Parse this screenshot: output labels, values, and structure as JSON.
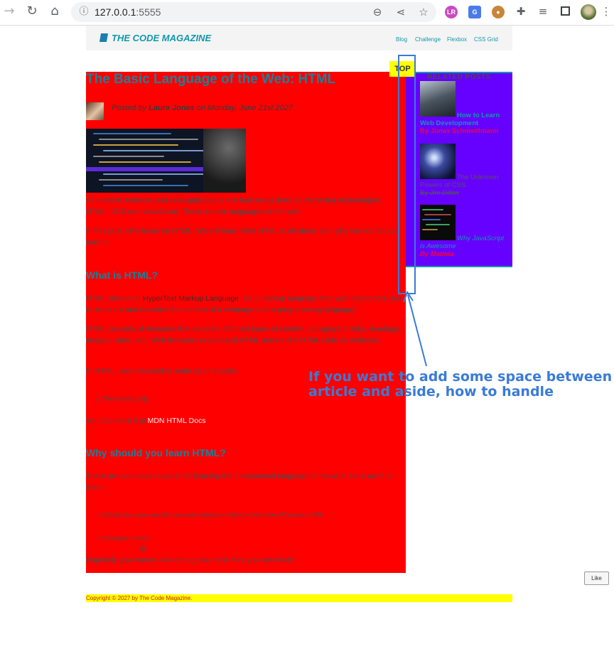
{
  "browser": {
    "url_host": "127.0.0.1",
    "url_port": ":5555"
  },
  "site": {
    "logo": "THE CODE MAGAZINE",
    "nav": [
      "Blog",
      "Challenge",
      "Flexbox",
      "CSS Grid"
    ]
  },
  "article": {
    "title": "The Basic Language of the Web: HTML",
    "byline_prefix": "Posted by",
    "author": "Laura Jones",
    "byline_mid": "on",
    "date": "Monday, June 21st 2027",
    "intro_1_a": "All modern websites and web applications are built using three",
    "intro_1_em": "fundamental",
    "intro_1_b": "technologies: HTML, CSS and JavaScript. These are the languages of the web.",
    "intro_2": "In this post, let's focus on HTML. We will learn what HTML is all about, and why you too should learn it.",
    "h2_1": "What is HTML?",
    "p_1_a": "HTML stands for",
    "p_1_term": "HyperText Markup Language",
    "p_1_b": ". It's a markup language that web developers use to structure and describe the content of a webpage (not a programming language).",
    "p_2": "HTML consists of elements that describe different types of content: paragraphs, links, headings, images, video, etc. Web browsers understand HTML and render HTML code as websites.",
    "p_3": "In HTML, each element is made up of 3 parts:",
    "list_item": "2. The closing tag",
    "p_4_prefix": "You can learn it at",
    "p_4_link": "MDN HTML Docs",
    "h2_2": "Why should you learn HTML?",
    "p_5": "There are countless reasons for learning the fundamental language of the web. Here are 5 of them:",
    "bullets": [
      "To build your own beautiful websites instead of relying on tools like Worpress or Wix",
      "To impress friends"
    ],
    "emoji": "😃",
    "closing": "Hopefully you learned something new here. See you next time!"
  },
  "aside": {
    "title": "RELATED POSTS",
    "posts": [
      {
        "title": "How to Learn Web Development",
        "author": "By Jonas Schmedtmann"
      },
      {
        "title": "The Unknown Powers of CSS",
        "author": "By Jim Dillon"
      },
      {
        "title": "Why JavaScript is Awesome",
        "author": "By Matilda"
      }
    ]
  },
  "top_button": "TOP",
  "annotation": [
    "If you want to add some space between",
    "article and aside, how to handle"
  ],
  "like_button": "Like",
  "footer": "Copyright © 2027 by The Code Magazine."
}
